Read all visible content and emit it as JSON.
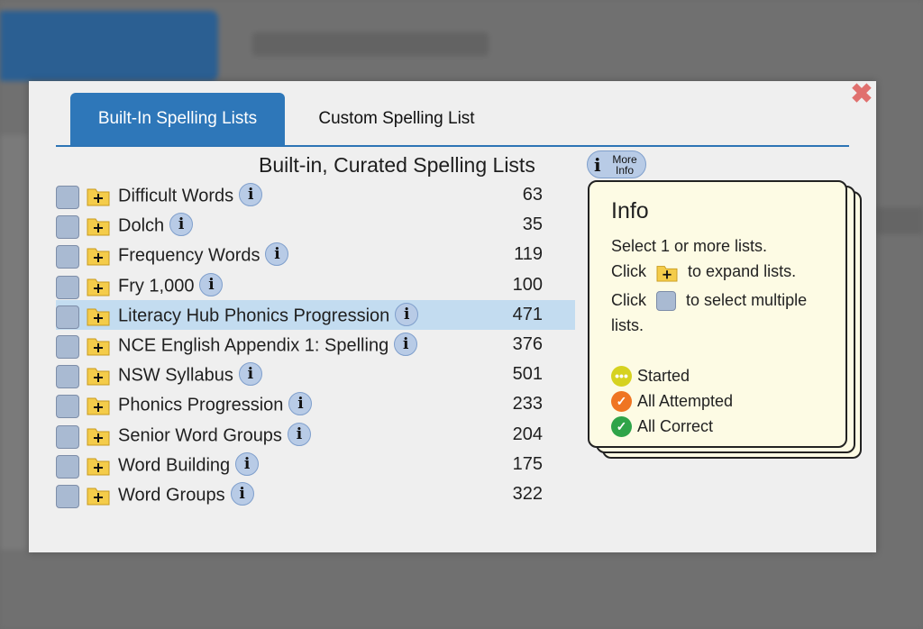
{
  "tabs": [
    {
      "label": "Built-In Spelling Lists",
      "active": true
    },
    {
      "label": "Custom Spelling List",
      "active": false
    }
  ],
  "heading": "Built-in, Curated Spelling Lists",
  "more_info": {
    "icon": "i",
    "text": "More Info"
  },
  "close_icon": "✖",
  "info_icon_glyph": "i",
  "lists": [
    {
      "name": "Difficult Words",
      "count": "63"
    },
    {
      "name": "Dolch",
      "count": "35"
    },
    {
      "name": "Frequency Words",
      "count": "119"
    },
    {
      "name": "Fry 1,000",
      "count": "100"
    },
    {
      "name": "Literacy Hub Phonics Progression",
      "count": "471",
      "highlighted": true
    },
    {
      "name": "NCE English Appendix 1: Spelling",
      "count": "376"
    },
    {
      "name": "NSW Syllabus",
      "count": "501"
    },
    {
      "name": "Phonics Progression",
      "count": "233"
    },
    {
      "name": "Senior Word Groups",
      "count": "204"
    },
    {
      "name": "Word Building",
      "count": "175"
    },
    {
      "name": "Word Groups",
      "count": "322"
    }
  ],
  "info_panel": {
    "title": "Info",
    "line1": "Select 1 or more lists.",
    "line2_pre": "Click",
    "line2_post": "to expand lists.",
    "line3_pre": "Click",
    "line3_post": "to select multiple",
    "line4": "lists.",
    "legend": [
      {
        "label": "Started",
        "icon": "started-icon",
        "glyph": "•••"
      },
      {
        "label": "All Attempted",
        "icon": "attempted-icon",
        "glyph": "✓"
      },
      {
        "label": "All Correct",
        "icon": "correct-icon",
        "glyph": "✓"
      }
    ]
  },
  "colors": {
    "accent": "#2e77b9",
    "highlight_row": "#c3dcf0",
    "close": "#e0706e",
    "info_bg": "#fdfbe4"
  }
}
